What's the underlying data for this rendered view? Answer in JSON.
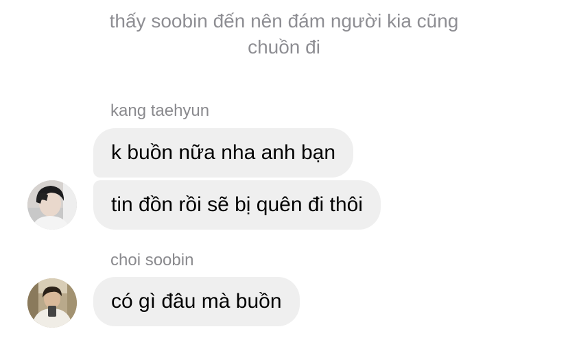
{
  "system_message": "thấy soobin đến nên đám người kia cũng\nchuồn đi",
  "groups": [
    {
      "sender": "kang taehyun",
      "avatar_icon": "user-avatar-photo",
      "messages": [
        "k buồn nữa nha anh bạn",
        "tin đồn rồi sẽ bị quên đi thôi"
      ]
    },
    {
      "sender": "choi soobin",
      "avatar_icon": "user-avatar-photo",
      "messages": [
        "có gì đâu mà buồn"
      ]
    }
  ],
  "colors": {
    "bubble_bg": "#efefef",
    "system_text": "#8e8e93",
    "sender_text": "#8a8a8e",
    "message_text": "#000000"
  }
}
